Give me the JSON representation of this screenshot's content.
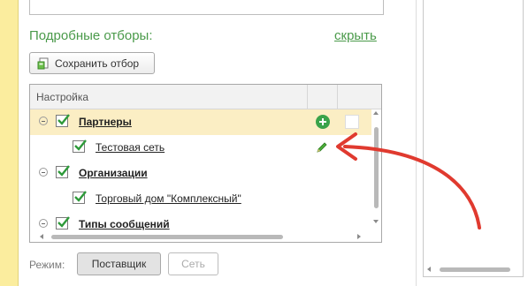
{
  "filters": {
    "title": "Подробные отборы:",
    "hide_link": "скрыть",
    "save_button": "Сохранить отбор"
  },
  "tree": {
    "column_header": "Настройка",
    "rows": [
      {
        "label": "Партнеры",
        "level": 0,
        "checked": true,
        "bold": true,
        "selected": true
      },
      {
        "label": "Тестовая сеть",
        "level": 1,
        "checked": true,
        "bold": false,
        "selected": false
      },
      {
        "label": "Организации",
        "level": 0,
        "checked": true,
        "bold": true,
        "selected": false
      },
      {
        "label": "Торговый дом \"Комплексный\"",
        "level": 1,
        "checked": true,
        "bold": false,
        "selected": false
      },
      {
        "label": "Типы сообщений",
        "level": 0,
        "checked": true,
        "bold": true,
        "selected": false
      }
    ]
  },
  "mode": {
    "label": "Режим:",
    "options": [
      "Поставщик",
      "Сеть"
    ],
    "active": "Поставщик"
  },
  "colors": {
    "accent_green": "#4a9a4a",
    "selected_row": "#fbeec4",
    "annotation_red": "#e03a2f"
  },
  "icons": [
    "save-filter-icon",
    "collapse-icon",
    "checkbox-icon",
    "add-icon",
    "edit-pencil-icon",
    "red-arrow-annotation"
  ]
}
